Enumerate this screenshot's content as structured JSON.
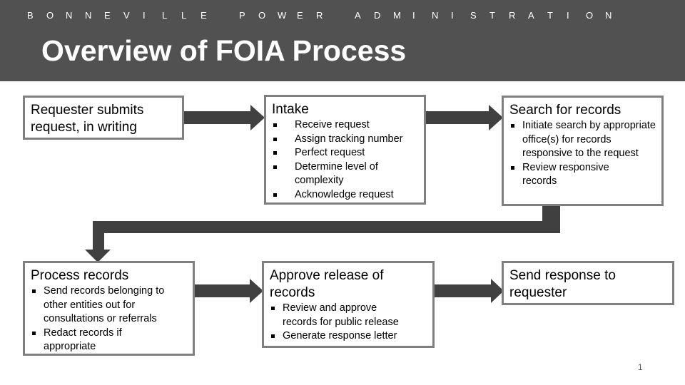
{
  "header": {
    "organization_letters": [
      "B",
      "O",
      "N",
      "N",
      "E",
      "V",
      "I",
      "L",
      "L",
      "E",
      "",
      "P",
      "O",
      "W",
      "E",
      "R",
      "",
      "A",
      "D",
      "M",
      "I",
      "N",
      "I",
      "S",
      "T",
      "R",
      "A",
      "T",
      "I",
      "O",
      "N"
    ],
    "organization": "BONNEVILLE POWER ADMINISTRATION",
    "title": "Overview of FOIA Process"
  },
  "colors": {
    "header_bg": "#515151",
    "arrow": "#404040",
    "box_border": "#7f7f7f"
  },
  "steps": [
    {
      "heading": "Requester submits request, in writing",
      "bullets": []
    },
    {
      "heading": "Intake",
      "bullets": [
        "Receive request",
        "Assign tracking number",
        "Perfect request",
        "Determine level of complexity",
        "Acknowledge request"
      ]
    },
    {
      "heading": "Search for records",
      "bullets": [
        "Initiate search by appropriate office(s) for records responsive to the request",
        "Review responsive records"
      ]
    },
    {
      "heading": "Process records",
      "bullets": [
        "Send records belonging to other entities out for consultations or referrals",
        "Redact records if appropriate"
      ]
    },
    {
      "heading": "Approve release of records",
      "bullets": [
        "Review and approve records for public release",
        "Generate response letter"
      ]
    },
    {
      "heading": "Send response to requester",
      "bullets": []
    }
  ],
  "footer": {
    "page_number": "1"
  }
}
